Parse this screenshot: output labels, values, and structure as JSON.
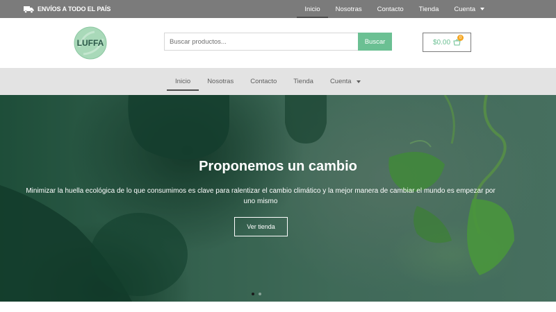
{
  "topbar": {
    "shipping_text": "ENVÍOS A TODO EL PAÍS",
    "nav": [
      {
        "label": "Inicio"
      },
      {
        "label": "Nosotras"
      },
      {
        "label": "Contacto"
      },
      {
        "label": "Tienda"
      },
      {
        "label": "Cuenta"
      }
    ]
  },
  "header": {
    "logo_text": "LUFFA",
    "search_placeholder": "Buscar productos...",
    "search_button": "Buscar",
    "cart_total": "$0.00",
    "cart_count": "0"
  },
  "mainnav": {
    "items": [
      {
        "label": "Inicio"
      },
      {
        "label": "Nosotras"
      },
      {
        "label": "Contacto"
      },
      {
        "label": "Tienda"
      },
      {
        "label": "Cuenta"
      }
    ]
  },
  "hero": {
    "title": "Proponemos un cambio",
    "text": "Minimizar la huella ecológica de lo que consumimos es clave para ralentizar el cambio climático y la mejor manera de cambiar el mundo es empezar por uno mismo",
    "button": "Ver tienda"
  },
  "colors": {
    "topbar": "#7b7b7b",
    "accent": "#6bc093",
    "badge": "#f5a623",
    "mainnav": "#e3e3e3"
  }
}
